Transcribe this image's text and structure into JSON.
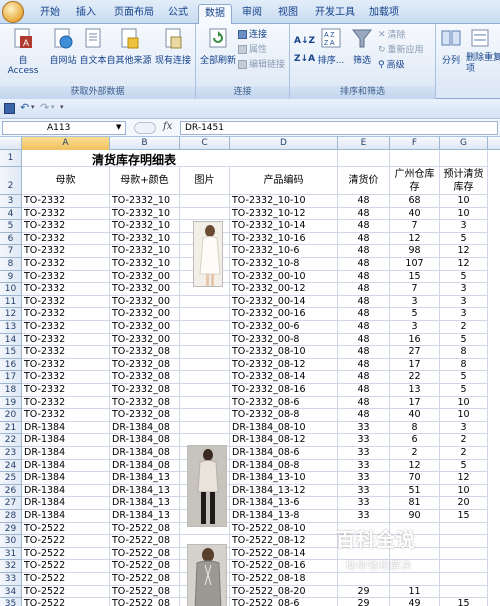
{
  "tabs": [
    "开始",
    "插入",
    "页面布局",
    "公式",
    "数据",
    "审阅",
    "视图",
    "开发工具",
    "加载项"
  ],
  "active_tab": "数据",
  "ribbon": {
    "external": {
      "label": "获取外部数据",
      "access": "自 Access",
      "web": "自网站",
      "text": "自文本",
      "other": "自其他来源",
      "existing": "现有连接"
    },
    "connections": {
      "label": "连接",
      "refresh_all": "全部刷新",
      "connections": "连接",
      "properties": "属性",
      "edit_links": "编辑链接"
    },
    "sort_filter": {
      "label": "排序和筛选",
      "sort": "排序...",
      "filter": "筛选",
      "clear": "清除",
      "reapply": "重新应用",
      "advanced": "高级"
    },
    "data_tools": {
      "split": "分列",
      "remove_dup": "删除重复项"
    }
  },
  "formula_bar": {
    "name_box": "A113",
    "fx": "fx",
    "formula": "DR-1451"
  },
  "columns": [
    "A",
    "B",
    "C",
    "D",
    "E",
    "F",
    "G"
  ],
  "sheet": {
    "title": "清货库存明细表",
    "headers": [
      "母款",
      "母款+颜色",
      "图片",
      "产品编码",
      "清货价",
      "广州仓库存",
      "预计清货库存"
    ],
    "rows": [
      {
        "n": "3",
        "a": "TO-2332",
        "b": "TO-2332_10",
        "d": "TO-2332_10-10",
        "e": "48",
        "f": "68",
        "g": "10"
      },
      {
        "n": "4",
        "a": "TO-2332",
        "b": "TO-2332_10",
        "d": "TO-2332_10-12",
        "e": "48",
        "f": "40",
        "g": "10"
      },
      {
        "n": "5",
        "a": "TO-2332",
        "b": "TO-2332_10",
        "d": "TO-2332_10-14",
        "e": "48",
        "f": "7",
        "g": "3"
      },
      {
        "n": "6",
        "a": "TO-2332",
        "b": "TO-2332_10",
        "d": "TO-2332_10-16",
        "e": "48",
        "f": "12",
        "g": "5"
      },
      {
        "n": "7",
        "a": "TO-2332",
        "b": "TO-2332_10",
        "d": "TO-2332_10-6",
        "e": "48",
        "f": "98",
        "g": "12"
      },
      {
        "n": "8",
        "a": "TO-2332",
        "b": "TO-2332_10",
        "d": "TO-2332_10-8",
        "e": "48",
        "f": "107",
        "g": "12"
      },
      {
        "n": "9",
        "a": "TO-2332",
        "b": "TO-2332_00",
        "d": "TO-2332_00-10",
        "e": "48",
        "f": "15",
        "g": "5"
      },
      {
        "n": "10",
        "a": "TO-2332",
        "b": "TO-2332_00",
        "d": "TO-2332_00-12",
        "e": "48",
        "f": "7",
        "g": "3"
      },
      {
        "n": "11",
        "a": "TO-2332",
        "b": "TO-2332_00",
        "d": "TO-2332_00-14",
        "e": "48",
        "f": "3",
        "g": "3"
      },
      {
        "n": "12",
        "a": "TO-2332",
        "b": "TO-2332_00",
        "d": "TO-2332_00-16",
        "e": "48",
        "f": "5",
        "g": "3"
      },
      {
        "n": "13",
        "a": "TO-2332",
        "b": "TO-2332_00",
        "d": "TO-2332_00-6",
        "e": "48",
        "f": "3",
        "g": "2"
      },
      {
        "n": "14",
        "a": "TO-2332",
        "b": "TO-2332_00",
        "d": "TO-2332_00-8",
        "e": "48",
        "f": "16",
        "g": "5"
      },
      {
        "n": "15",
        "a": "TO-2332",
        "b": "TO-2332_08",
        "d": "TO-2332_08-10",
        "e": "48",
        "f": "27",
        "g": "8"
      },
      {
        "n": "16",
        "a": "TO-2332",
        "b": "TO-2332_08",
        "d": "TO-2332_08-12",
        "e": "48",
        "f": "17",
        "g": "8"
      },
      {
        "n": "17",
        "a": "TO-2332",
        "b": "TO-2332_08",
        "d": "TO-2332_08-14",
        "e": "48",
        "f": "22",
        "g": "5"
      },
      {
        "n": "18",
        "a": "TO-2332",
        "b": "TO-2332_08",
        "d": "TO-2332_08-16",
        "e": "48",
        "f": "13",
        "g": "5"
      },
      {
        "n": "19",
        "a": "TO-2332",
        "b": "TO-2332_08",
        "d": "TO-2332_08-6",
        "e": "48",
        "f": "17",
        "g": "10"
      },
      {
        "n": "20",
        "a": "TO-2332",
        "b": "TO-2332_08",
        "d": "TO-2332_08-8",
        "e": "48",
        "f": "40",
        "g": "10"
      },
      {
        "n": "21",
        "a": "DR-1384",
        "b": "DR-1384_08",
        "d": "DR-1384_08-10",
        "e": "33",
        "f": "8",
        "g": "3"
      },
      {
        "n": "22",
        "a": "DR-1384",
        "b": "DR-1384_08",
        "d": "DR-1384_08-12",
        "e": "33",
        "f": "6",
        "g": "2"
      },
      {
        "n": "23",
        "a": "DR-1384",
        "b": "DR-1384_08",
        "d": "DR-1384_08-6",
        "e": "33",
        "f": "2",
        "g": "2"
      },
      {
        "n": "24",
        "a": "DR-1384",
        "b": "DR-1384_08",
        "d": "DR-1384_08-8",
        "e": "33",
        "f": "12",
        "g": "5"
      },
      {
        "n": "25",
        "a": "DR-1384",
        "b": "DR-1384_13",
        "d": "DR-1384_13-10",
        "e": "33",
        "f": "70",
        "g": "12"
      },
      {
        "n": "26",
        "a": "DR-1384",
        "b": "DR-1384_13",
        "d": "DR-1384_13-12",
        "e": "33",
        "f": "51",
        "g": "10"
      },
      {
        "n": "27",
        "a": "DR-1384",
        "b": "DR-1384_13",
        "d": "DR-1384_13-6",
        "e": "33",
        "f": "81",
        "g": "20"
      },
      {
        "n": "28",
        "a": "DR-1384",
        "b": "DR-1384_13",
        "d": "DR-1384_13-8",
        "e": "33",
        "f": "90",
        "g": "15"
      },
      {
        "n": "29",
        "a": "TO-2522",
        "b": "TO-2522_08",
        "d": "TO-2522_08-10",
        "e": "",
        "f": "",
        "g": ""
      },
      {
        "n": "30",
        "a": "TO-2522",
        "b": "TO-2522_08",
        "d": "TO-2522_08-12",
        "e": "",
        "f": "",
        "g": ""
      },
      {
        "n": "31",
        "a": "TO-2522",
        "b": "TO-2522_08",
        "d": "TO-2522_08-14",
        "e": "",
        "f": "",
        "g": ""
      },
      {
        "n": "32",
        "a": "TO-2522",
        "b": "TO-2522_08",
        "d": "TO-2522_08-16",
        "e": "",
        "f": "",
        "g": ""
      },
      {
        "n": "33",
        "a": "TO-2522",
        "b": "TO-2522_08",
        "d": "TO-2522_08-18",
        "e": "",
        "f": "",
        "g": ""
      },
      {
        "n": "34",
        "a": "TO-2522",
        "b": "TO-2522_08",
        "d": "TO-2522_08-20",
        "e": "29",
        "f": "11",
        "g": ""
      },
      {
        "n": "35",
        "a": "TO-2522",
        "b": "TO-2522_08",
        "d": "TO-2522_08-6",
        "e": "29",
        "f": "49",
        "g": "15"
      }
    ]
  },
  "watermark": {
    "title": "百科全说",
    "subtitle": "助你轻松解决"
  },
  "colors": {
    "ribbon_text": "#15428b",
    "selected_col": "#f1c15f",
    "grid_line": "#d0d7e5"
  }
}
